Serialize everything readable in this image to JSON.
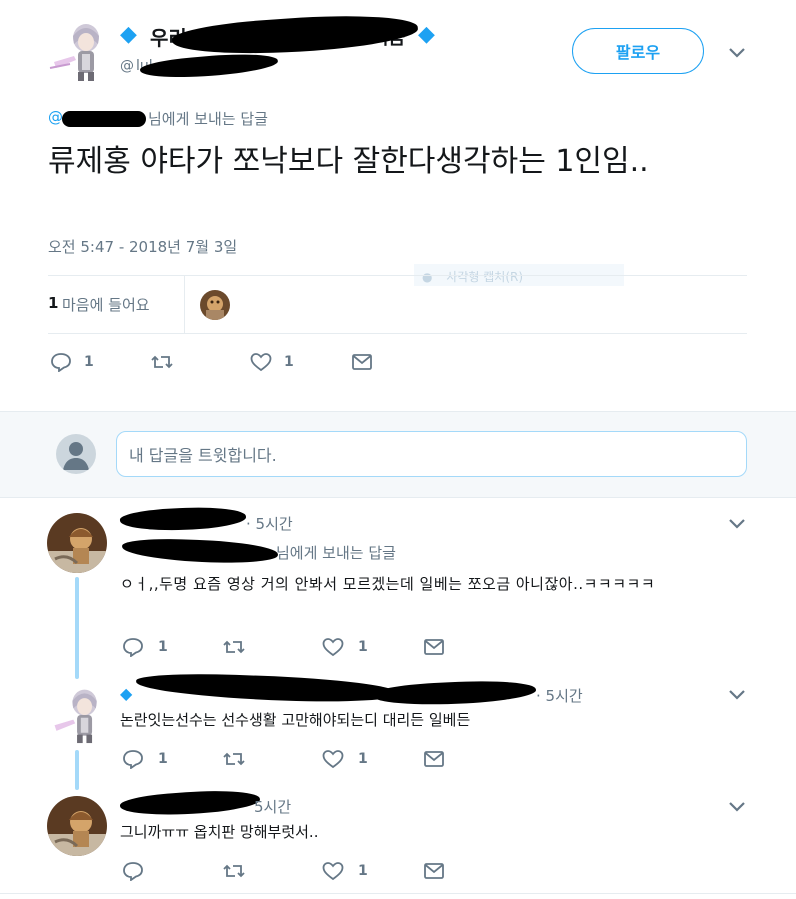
{
  "main_tweet": {
    "name_fragment": "우리",
    "name_tail": "지금",
    "handle_prefix": "@",
    "handle_visible": "lul",
    "follow_label": "팔로우",
    "reply_to_handle": "@",
    "reply_to_suffix": "님에게 보내는 답글",
    "text": "류제홍 야타가 쪼낙보다  잘한다생각하는 1인임..",
    "timestamp": "오전 5:47 - 2018년 7월 3일",
    "likes_count": "1",
    "likes_label": "마음에 들어요",
    "reply_count": "1",
    "retweet_count": "",
    "heart_count": "1"
  },
  "tooltip_ghost": "사각형 캡처(R)",
  "reply_input": {
    "placeholder": "내 답글을 트윗합니다."
  },
  "replies": [
    {
      "handle_fragment": "@",
      "time": "· 5시간",
      "reply_to_suffix": "님에게 보내는 답글",
      "text": "ㅇㅓ,,두명 요즘 영상 거의 안봐서 모르겠는데 일베는 쪼오금 아니잖아..ㅋㅋㅋㅋㅋ",
      "reply_count": "1",
      "heart_count": "1"
    },
    {
      "handle_fragment": "@",
      "time": "· 5시간",
      "text": "논란잇는선수는 선수생활 고만해야되는디 대리든 일베든",
      "reply_count": "1",
      "heart_count": "1"
    },
    {
      "time": "5시간",
      "text": "그니까ㅠㅠ 옵치판 망해부럿서..",
      "reply_count": "",
      "heart_count": "1"
    }
  ],
  "colors": {
    "accent": "#1da1f2",
    "muted": "#657786",
    "divider": "#e6ecf0",
    "thread": "#a4d9f9"
  },
  "icons": [
    "gem-icon",
    "chevron-down-icon",
    "reply-icon",
    "retweet-icon",
    "heart-icon",
    "message-icon",
    "default-avatar-icon"
  ]
}
